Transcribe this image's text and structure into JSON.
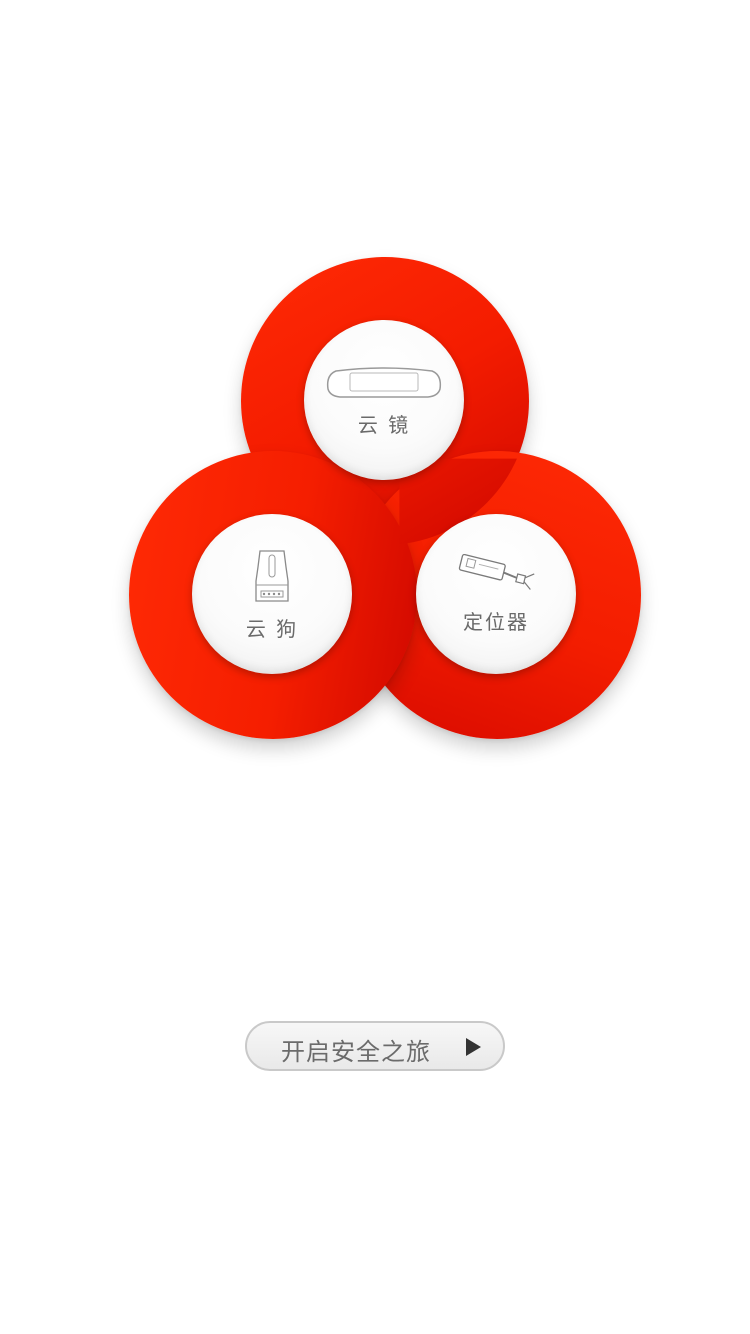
{
  "devices": [
    {
      "id": "mirror",
      "label": "云 镜",
      "icon": "rearview-mirror-icon"
    },
    {
      "id": "dog",
      "label": "云 狗",
      "icon": "radar-detector-icon"
    },
    {
      "id": "locator",
      "label": "定位器",
      "icon": "gps-locator-icon"
    }
  ],
  "start_button": {
    "label": "开启安全之旅",
    "icon": "play-icon"
  },
  "colors": {
    "ring": "#f41c00",
    "ring_dark": "#cf0800",
    "inner_circle": "#fbfbfb",
    "label_text": "#6a6a6a",
    "button_bg": "#efefef",
    "button_border": "#c9c9c9"
  }
}
